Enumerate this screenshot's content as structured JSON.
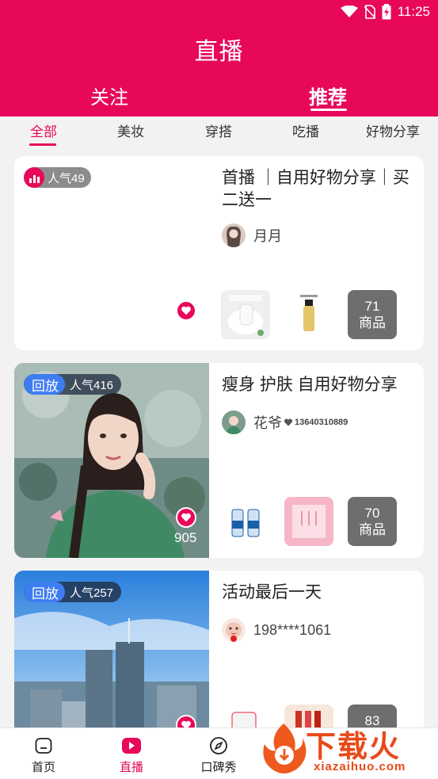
{
  "status": {
    "time": "11:25"
  },
  "header": {
    "title": "直播",
    "tabs": [
      {
        "label": "关注"
      },
      {
        "label": "推荐"
      }
    ]
  },
  "categories": [
    "全部",
    "美妆",
    "穿搭",
    "吃播",
    "好物分享"
  ],
  "cards": [
    {
      "badge_popularity": "人气49",
      "title": "首播 ｜自用好物分享｜买二送一",
      "host": "月月",
      "product_count": "71",
      "product_unit": "商品"
    },
    {
      "badge_replay": "回放",
      "badge_popularity": "人气416",
      "likes": "905",
      "title": "瘦身 护肤 自用好物分享",
      "host": "花爷",
      "host_phone": "13640310889",
      "product_count": "70",
      "product_unit": "商品"
    },
    {
      "badge_replay": "回放",
      "badge_popularity": "人气257",
      "title": "活动最后一天",
      "host": "198****1061",
      "product_count": "83"
    }
  ],
  "bottom_nav": [
    {
      "label": "首页"
    },
    {
      "label": "直播"
    },
    {
      "label": "口碑秀"
    }
  ],
  "watermark": {
    "text": "下载火",
    "url": "xiazaihuo.com"
  },
  "colors": {
    "brand": "#e8085a",
    "replay": "#3e7cf0"
  }
}
